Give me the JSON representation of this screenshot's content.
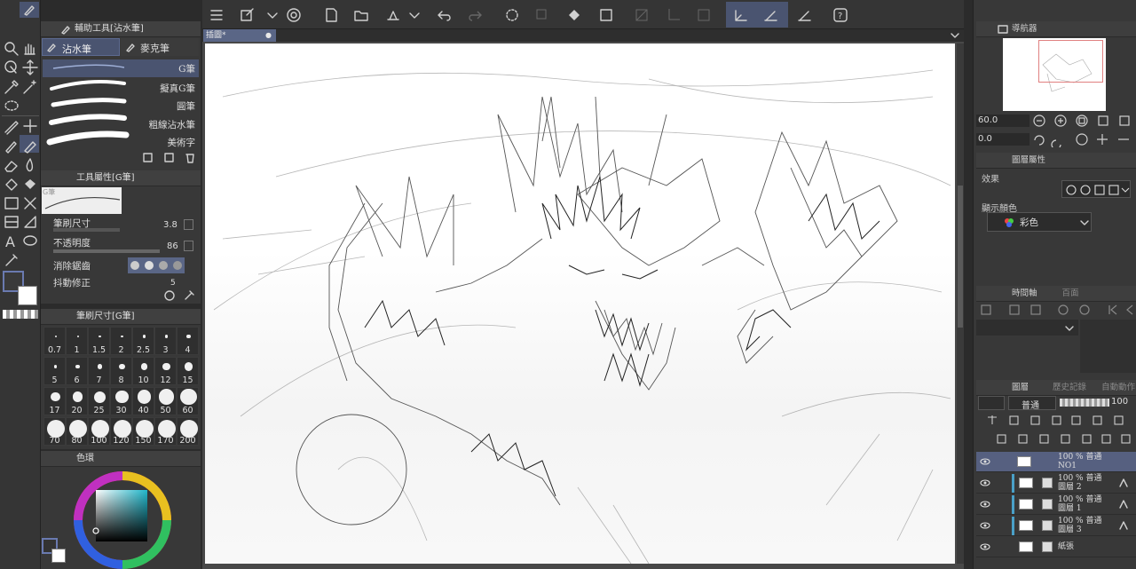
{
  "tool_panel": {
    "header_title": "輔助工具[沾水筆]",
    "tabs": [
      "沾水筆",
      "麥克筆"
    ],
    "brushes": [
      "G筆",
      "擬真G筆",
      "圓筆",
      "粗線沾水筆",
      "美術字"
    ]
  },
  "tool_property": {
    "header_title": "工具屬性[G筆]",
    "preview_label": "G筆",
    "brush_size_label": "筆刷尺寸",
    "brush_size_value": "3.8",
    "opacity_label": "不透明度",
    "opacity_value": "86",
    "antialias_label": "消除鋸齒",
    "stabilization_label": "抖動修正",
    "stabilization_value": "5"
  },
  "brush_size_panel": {
    "header_title": "筆刷尺寸[G筆]",
    "sizes": [
      "0.7",
      "1",
      "1.5",
      "2",
      "2.5",
      "3",
      "4",
      "5",
      "6",
      "7",
      "8",
      "10",
      "12",
      "15",
      "17",
      "20",
      "25",
      "30",
      "40",
      "50",
      "60",
      "70",
      "80",
      "100",
      "120",
      "150",
      "170",
      "200"
    ]
  },
  "color_panel": {
    "header_title": "色環"
  },
  "document": {
    "tab_label": "插圖*"
  },
  "navigator": {
    "header_title": "導航器",
    "zoom_value": "60.0",
    "rotate_value": "0.0"
  },
  "layer_property": {
    "header_title": "圖層屬性",
    "effect_label": "效果",
    "display_color_label": "顯示顏色",
    "display_color_value": "彩色"
  },
  "timeline": {
    "header_title": "時間軸",
    "tab2": "百面"
  },
  "layers_panel": {
    "tabs": [
      "圖層",
      "歷史記錄",
      "自動動作"
    ],
    "blend_mode": "普通",
    "opacity": "100",
    "layers": [
      {
        "line1": "100 % 普通",
        "line2": "NO1",
        "selected": true
      },
      {
        "line1": "100 % 普通",
        "line2": "圖層 2",
        "selected": false
      },
      {
        "line1": "100 % 普通",
        "line2": "圖層 1",
        "selected": false
      },
      {
        "line1": "100 % 普通",
        "line2": "圖層 3",
        "selected": false
      },
      {
        "line1": "紙張",
        "line2": "",
        "selected": false
      }
    ]
  },
  "colors": {
    "accent": "#5a6686",
    "panel": "#383838",
    "selected_layer": "#566080"
  }
}
